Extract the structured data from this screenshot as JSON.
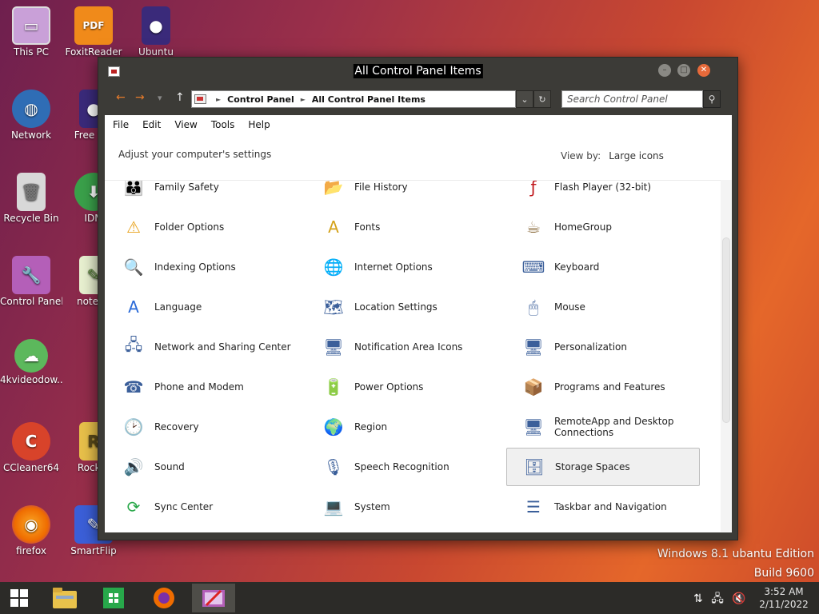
{
  "desktop": {
    "icons": [
      {
        "label": "This PC"
      },
      {
        "label": "FoxitReader"
      },
      {
        "label": "Ubuntu"
      },
      {
        "label": "Network"
      },
      {
        "label": "Free Sof"
      },
      {
        "label": "Recycle Bin"
      },
      {
        "label": "IDM"
      },
      {
        "label": "Control Panel"
      },
      {
        "label": "notepa"
      },
      {
        "label": "4kvideodow..."
      },
      {
        "label": "CCleaner64"
      },
      {
        "label": "Rocket"
      },
      {
        "label": "firefox"
      },
      {
        "label": "SmartFlip"
      }
    ],
    "watermark_line1": "Windows 8.1 ubantu Edition",
    "watermark_line2": "Build 9600"
  },
  "window": {
    "title": "All Control Panel Items",
    "buttons": {
      "min": "–",
      "max": "□",
      "close": "✕"
    },
    "nav": {
      "back": "←",
      "forward": "→",
      "recent": "▾",
      "up": "↑"
    },
    "breadcrumb": [
      "Control Panel",
      "All Control Panel Items"
    ],
    "breadcrumb_sep": "►",
    "dropdown": "⌄",
    "refresh": "↻",
    "search_placeholder": "Search Control Panel",
    "search_icon": "⚲",
    "menu": [
      "File",
      "Edit",
      "View",
      "Tools",
      "Help"
    ],
    "header": "Adjust your computer's settings",
    "view_by_label": "View by:",
    "view_by_value": "Large icons",
    "items": [
      {
        "label": "Family Safety",
        "icon": "family-safety-icon",
        "glyph": "👪"
      },
      {
        "label": "File History",
        "icon": "file-history-icon",
        "glyph": "📂"
      },
      {
        "label": "Flash Player (32-bit)",
        "icon": "flash-player-icon",
        "glyph": "ƒ"
      },
      {
        "label": "Folder Options",
        "icon": "folder-options-icon",
        "glyph": "⚠"
      },
      {
        "label": "Fonts",
        "icon": "fonts-icon",
        "glyph": "A"
      },
      {
        "label": "HomeGroup",
        "icon": "homegroup-icon",
        "glyph": "☕"
      },
      {
        "label": "Indexing Options",
        "icon": "indexing-options-icon",
        "glyph": "🔍"
      },
      {
        "label": "Internet Options",
        "icon": "internet-options-icon",
        "glyph": "🌐"
      },
      {
        "label": "Keyboard",
        "icon": "keyboard-icon",
        "glyph": "⌨"
      },
      {
        "label": "Language",
        "icon": "language-icon",
        "glyph": "A"
      },
      {
        "label": "Location Settings",
        "icon": "location-settings-icon",
        "glyph": "🗺"
      },
      {
        "label": "Mouse",
        "icon": "mouse-icon",
        "glyph": "🖱"
      },
      {
        "label": "Network and Sharing Center",
        "icon": "network-sharing-icon",
        "glyph": "🖧"
      },
      {
        "label": "Notification Area Icons",
        "icon": "notification-area-icon",
        "glyph": "🖥"
      },
      {
        "label": "Personalization",
        "icon": "personalization-icon",
        "glyph": "🖥"
      },
      {
        "label": "Phone and Modem",
        "icon": "phone-modem-icon",
        "glyph": "☎"
      },
      {
        "label": "Power Options",
        "icon": "power-options-icon",
        "glyph": "🔋"
      },
      {
        "label": "Programs and Features",
        "icon": "programs-features-icon",
        "glyph": "📦"
      },
      {
        "label": "Recovery",
        "icon": "recovery-icon",
        "glyph": "🕑"
      },
      {
        "label": "Region",
        "icon": "region-icon",
        "glyph": "🌍"
      },
      {
        "label": "RemoteApp and Desktop Connections",
        "icon": "remoteapp-icon",
        "glyph": "🖥"
      },
      {
        "label": "Sound",
        "icon": "sound-icon",
        "glyph": "🔊"
      },
      {
        "label": "Speech Recognition",
        "icon": "speech-recognition-icon",
        "glyph": "🎙"
      },
      {
        "label": "Storage Spaces",
        "icon": "storage-spaces-icon",
        "glyph": "🗄"
      },
      {
        "label": "Sync Center",
        "icon": "sync-center-icon",
        "glyph": "⟳"
      },
      {
        "label": "System",
        "icon": "system-icon",
        "glyph": "💻"
      },
      {
        "label": "Taskbar and Navigation",
        "icon": "taskbar-navigation-icon",
        "glyph": "☰"
      }
    ],
    "selected_item": "Storage Spaces"
  },
  "taskbar": {
    "items": [
      "start-button",
      "file-explorer",
      "store",
      "firefox",
      "control-panel"
    ],
    "clock_time": "3:52 AM",
    "clock_date": "2/11/2022"
  }
}
